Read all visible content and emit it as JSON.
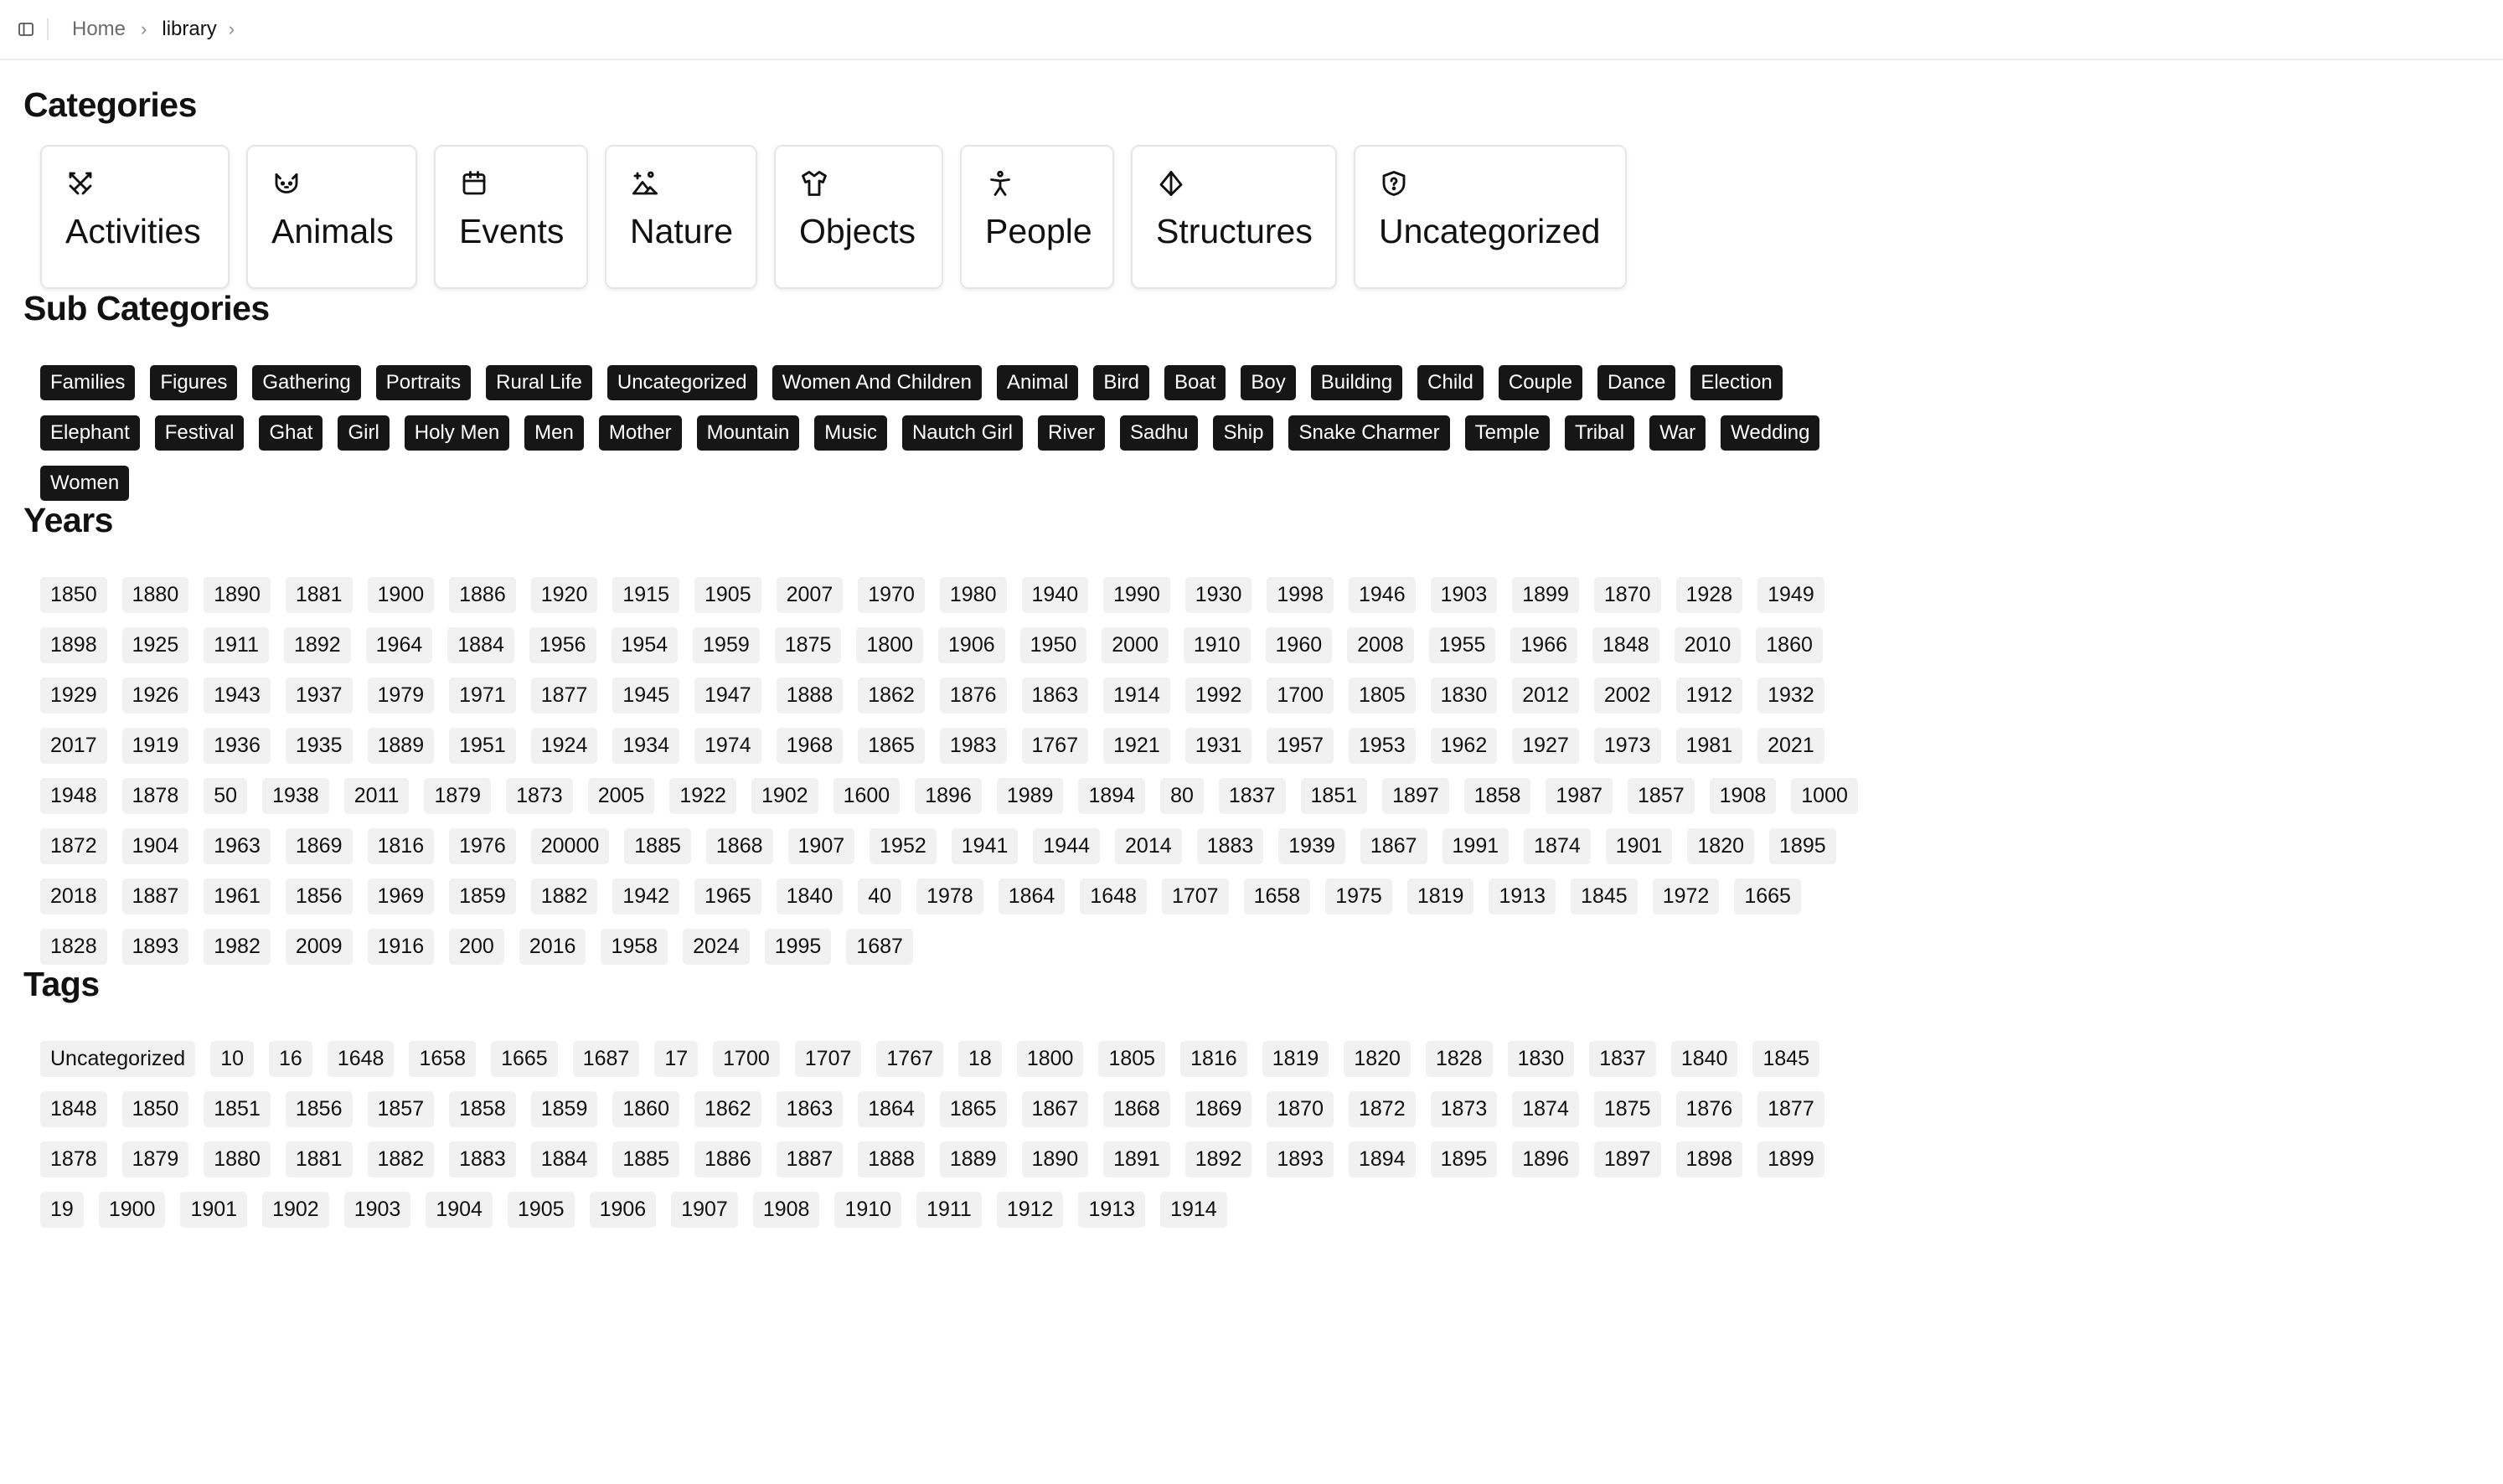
{
  "breadcrumb": {
    "home": "Home",
    "current": "library"
  },
  "categories": {
    "heading": "Categories",
    "items": [
      {
        "label": "Activities",
        "icon": "swords-icon"
      },
      {
        "label": "Animals",
        "icon": "cat-icon"
      },
      {
        "label": "Events",
        "icon": "calendar-icon"
      },
      {
        "label": "Nature",
        "icon": "landscape-icon"
      },
      {
        "label": "Objects",
        "icon": "shirt-icon"
      },
      {
        "label": "People",
        "icon": "person-icon"
      },
      {
        "label": "Structures",
        "icon": "tent-icon"
      },
      {
        "label": "Uncategorized",
        "icon": "shield-question-icon"
      }
    ]
  },
  "subcategories": {
    "heading": "Sub Categories",
    "items": [
      "Families",
      "Figures",
      "Gathering",
      "Portraits",
      "Rural Life",
      "Uncategorized",
      "Women And Children",
      "Animal",
      "Bird",
      "Boat",
      "Boy",
      "Building",
      "Child",
      "Couple",
      "Dance",
      "Election",
      "Elephant",
      "Festival",
      "Ghat",
      "Girl",
      "Holy Men",
      "Men",
      "Mother",
      "Mountain",
      "Music",
      "Nautch Girl",
      "River",
      "Sadhu",
      "Ship",
      "Snake Charmer",
      "Temple",
      "Tribal",
      "War",
      "Wedding",
      "Women"
    ]
  },
  "years": {
    "heading": "Years",
    "items": [
      "1850",
      "1880",
      "1890",
      "1881",
      "1900",
      "1886",
      "1920",
      "1915",
      "1905",
      "2007",
      "1970",
      "1980",
      "1940",
      "1990",
      "1930",
      "1998",
      "1946",
      "1903",
      "1899",
      "1870",
      "1928",
      "1949",
      "1898",
      "1925",
      "1911",
      "1892",
      "1964",
      "1884",
      "1956",
      "1954",
      "1959",
      "1875",
      "1800",
      "1906",
      "1950",
      "2000",
      "1910",
      "1960",
      "2008",
      "1955",
      "1966",
      "1848",
      "2010",
      "1860",
      "1929",
      "1926",
      "1943",
      "1937",
      "1979",
      "1971",
      "1877",
      "1945",
      "1947",
      "1888",
      "1862",
      "1876",
      "1863",
      "1914",
      "1992",
      "1700",
      "1805",
      "1830",
      "2012",
      "2002",
      "1912",
      "1932",
      "2017",
      "1919",
      "1936",
      "1935",
      "1889",
      "1951",
      "1924",
      "1934",
      "1974",
      "1968",
      "1865",
      "1983",
      "1767",
      "1921",
      "1931",
      "1957",
      "1953",
      "1962",
      "1927",
      "1973",
      "1981",
      "2021",
      "1948",
      "1878",
      "50",
      "1938",
      "2011",
      "1879",
      "1873",
      "2005",
      "1922",
      "1902",
      "1600",
      "1896",
      "1989",
      "1894",
      "80",
      "1837",
      "1851",
      "1897",
      "1858",
      "1987",
      "1857",
      "1908",
      "1000",
      "1872",
      "1904",
      "1963",
      "1869",
      "1816",
      "1976",
      "20000",
      "1885",
      "1868",
      "1907",
      "1952",
      "1941",
      "1944",
      "2014",
      "1883",
      "1939",
      "1867",
      "1991",
      "1874",
      "1901",
      "1820",
      "1895",
      "2018",
      "1887",
      "1961",
      "1856",
      "1969",
      "1859",
      "1882",
      "1942",
      "1965",
      "1840",
      "40",
      "1978",
      "1864",
      "1648",
      "1707",
      "1658",
      "1975",
      "1819",
      "1913",
      "1845",
      "1972",
      "1665",
      "1828",
      "1893",
      "1982",
      "2009",
      "1916",
      "200",
      "2016",
      "1958",
      "2024",
      "1995",
      "1687"
    ]
  },
  "tags": {
    "heading": "Tags",
    "items": [
      "Uncategorized",
      "10",
      "16",
      "1648",
      "1658",
      "1665",
      "1687",
      "17",
      "1700",
      "1707",
      "1767",
      "18",
      "1800",
      "1805",
      "1816",
      "1819",
      "1820",
      "1828",
      "1830",
      "1837",
      "1840",
      "1845",
      "1848",
      "1850",
      "1851",
      "1856",
      "1857",
      "1858",
      "1859",
      "1860",
      "1862",
      "1863",
      "1864",
      "1865",
      "1867",
      "1868",
      "1869",
      "1870",
      "1872",
      "1873",
      "1874",
      "1875",
      "1876",
      "1877",
      "1878",
      "1879",
      "1880",
      "1881",
      "1882",
      "1883",
      "1884",
      "1885",
      "1886",
      "1887",
      "1888",
      "1889",
      "1890",
      "1891",
      "1892",
      "1893",
      "1894",
      "1895",
      "1896",
      "1897",
      "1898",
      "1899",
      "19",
      "1900",
      "1901",
      "1902",
      "1903",
      "1904",
      "1905",
      "1906",
      "1907",
      "1908",
      "1910",
      "1911",
      "1912",
      "1913",
      "1914"
    ]
  }
}
